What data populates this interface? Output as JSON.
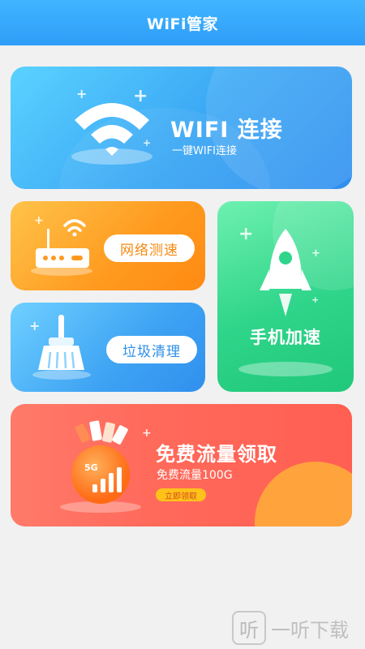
{
  "header": {
    "title": "WiFi管家"
  },
  "wifi_card": {
    "title": "WIFI 连接",
    "subtitle": "一键WIFI连接",
    "icon": "wifi-icon"
  },
  "speed_card": {
    "label": "网络测速",
    "icon": "router-icon"
  },
  "clean_card": {
    "label": "垃圾清理",
    "icon": "broom-icon"
  },
  "boost_card": {
    "label": "手机加速",
    "icon": "rocket-icon"
  },
  "free_card": {
    "title": "免费流量领取",
    "subtitle": "免费流量100G",
    "button_label": "立即领取",
    "badge": "5G",
    "icon": "signal-bars-icon"
  },
  "watermark": {
    "logo_char": "听",
    "text": "一听下载"
  },
  "colors": {
    "header": "#2f9df8",
    "wifi_card": "#3aa6f4",
    "speed_card": "#ff9a1f",
    "clean_card": "#3ea3f3",
    "boost_card": "#2fd58a",
    "free_card": "#ff6a5b",
    "free_button": "#ffc21a"
  }
}
